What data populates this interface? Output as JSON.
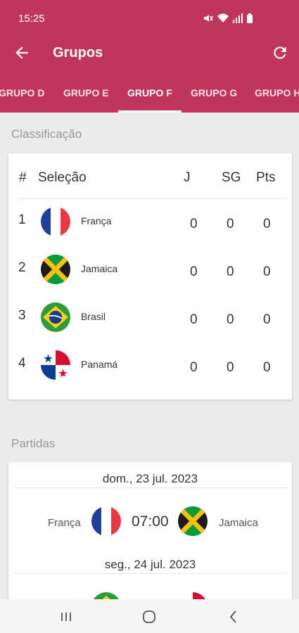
{
  "status_bar": {
    "time": "15:25"
  },
  "header": {
    "title": "Grupos",
    "back_icon": "arrow-left-icon",
    "refresh_icon": "refresh-icon"
  },
  "tabs": [
    {
      "label": "GRUPO D",
      "active": false
    },
    {
      "label": "GRUPO E",
      "active": false
    },
    {
      "label": "GRUPO F",
      "active": true
    },
    {
      "label": "GRUPO G",
      "active": false
    },
    {
      "label": "GRUPO H",
      "active": false
    }
  ],
  "standings": {
    "section_title": "Classificação",
    "headers": {
      "pos": "#",
      "team": "Seleção",
      "played": "J",
      "goal_diff": "SG",
      "points": "Pts"
    },
    "rows": [
      {
        "pos": "1",
        "team": "França",
        "flag": "france-flag-icon",
        "played": "0",
        "goal_diff": "0",
        "points": "0"
      },
      {
        "pos": "2",
        "team": "Jamaica",
        "flag": "jamaica-flag-icon",
        "played": "0",
        "goal_diff": "0",
        "points": "0"
      },
      {
        "pos": "3",
        "team": "Brasil",
        "flag": "brazil-flag-icon",
        "played": "0",
        "goal_diff": "0",
        "points": "0"
      },
      {
        "pos": "4",
        "team": "Panamá",
        "flag": "panama-flag-icon",
        "played": "0",
        "goal_diff": "0",
        "points": "0"
      }
    ]
  },
  "matches": {
    "section_title": "Partidas",
    "days": [
      {
        "date": "dom., 23 jul. 2023",
        "home": "França",
        "home_flag": "france-flag-icon",
        "time": "07:00",
        "away": "Jamaica",
        "away_flag": "jamaica-flag-icon"
      },
      {
        "date": "seg., 24 jul. 2023",
        "home_flag": "brazil-flag-icon",
        "away_flag": "panama-flag-icon"
      }
    ]
  },
  "colors": {
    "primary": "#c0355b",
    "background": "#ebebeb",
    "card": "#ffffff"
  }
}
